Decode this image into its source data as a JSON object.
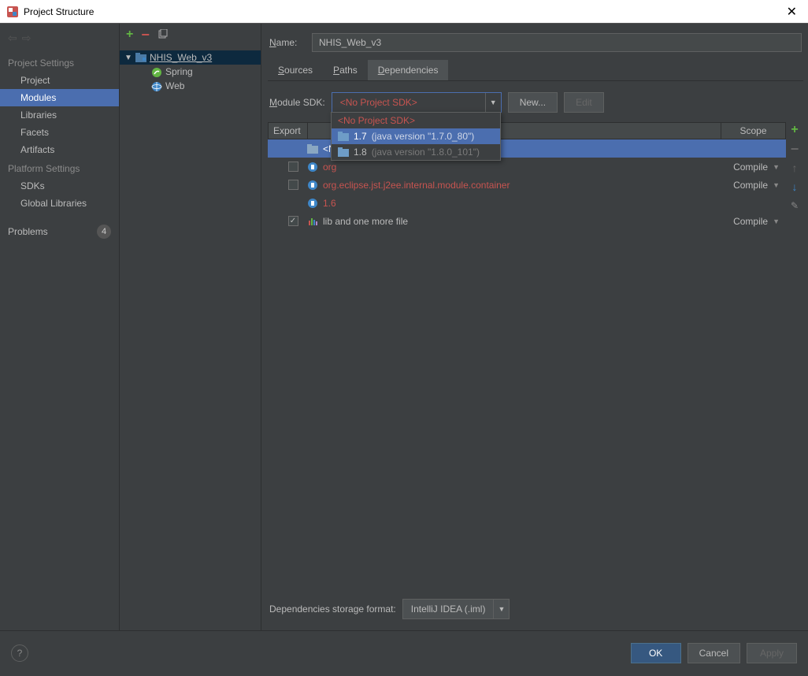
{
  "window": {
    "title": "Project Structure"
  },
  "sidebar": {
    "sections": {
      "project_settings": "Project Settings",
      "platform_settings": "Platform Settings"
    },
    "items": {
      "project": "Project",
      "modules": "Modules",
      "libraries": "Libraries",
      "facets": "Facets",
      "artifacts": "Artifacts",
      "sdks": "SDKs",
      "global_libraries": "Global Libraries"
    },
    "problems": {
      "label": "Problems",
      "count": "4"
    }
  },
  "tree": {
    "root": "NHIS_Web_v3",
    "children": [
      {
        "label": "Spring"
      },
      {
        "label": "Web"
      }
    ]
  },
  "main": {
    "name_label": "Name:",
    "name_value": "NHIS_Web_v3",
    "tabs": {
      "sources": "Sources",
      "paths": "Paths",
      "dependencies": "Dependencies"
    },
    "sdk": {
      "label": "Module SDK:",
      "selected": "<No Project SDK>",
      "new_btn": "New...",
      "edit_btn": "Edit",
      "options": [
        {
          "label": "<No Project SDK>",
          "kind": "none"
        },
        {
          "label": "1.7",
          "version": "(java version \"1.7.0_80\")"
        },
        {
          "label": "1.8",
          "version": "(java version \"1.8.0_101\")"
        }
      ]
    },
    "dep_header": {
      "export": "Export",
      "scope": "Scope"
    },
    "dependencies": [
      {
        "checkbox": null,
        "label": "<N",
        "selected": true
      },
      {
        "checkbox": false,
        "label": "org",
        "error": true,
        "scope": "Compile"
      },
      {
        "checkbox": false,
        "label": "org.eclipse.jst.j2ee.internal.module.container",
        "error": true,
        "scope": "Compile"
      },
      {
        "checkbox": null,
        "label": "1.6",
        "error": true
      },
      {
        "checkbox": true,
        "label": "lib and one more file",
        "scope": "Compile"
      }
    ],
    "storage": {
      "label": "Dependencies storage format:",
      "value": "IntelliJ IDEA (.iml)"
    }
  },
  "footer": {
    "ok": "OK",
    "cancel": "Cancel",
    "apply": "Apply"
  }
}
